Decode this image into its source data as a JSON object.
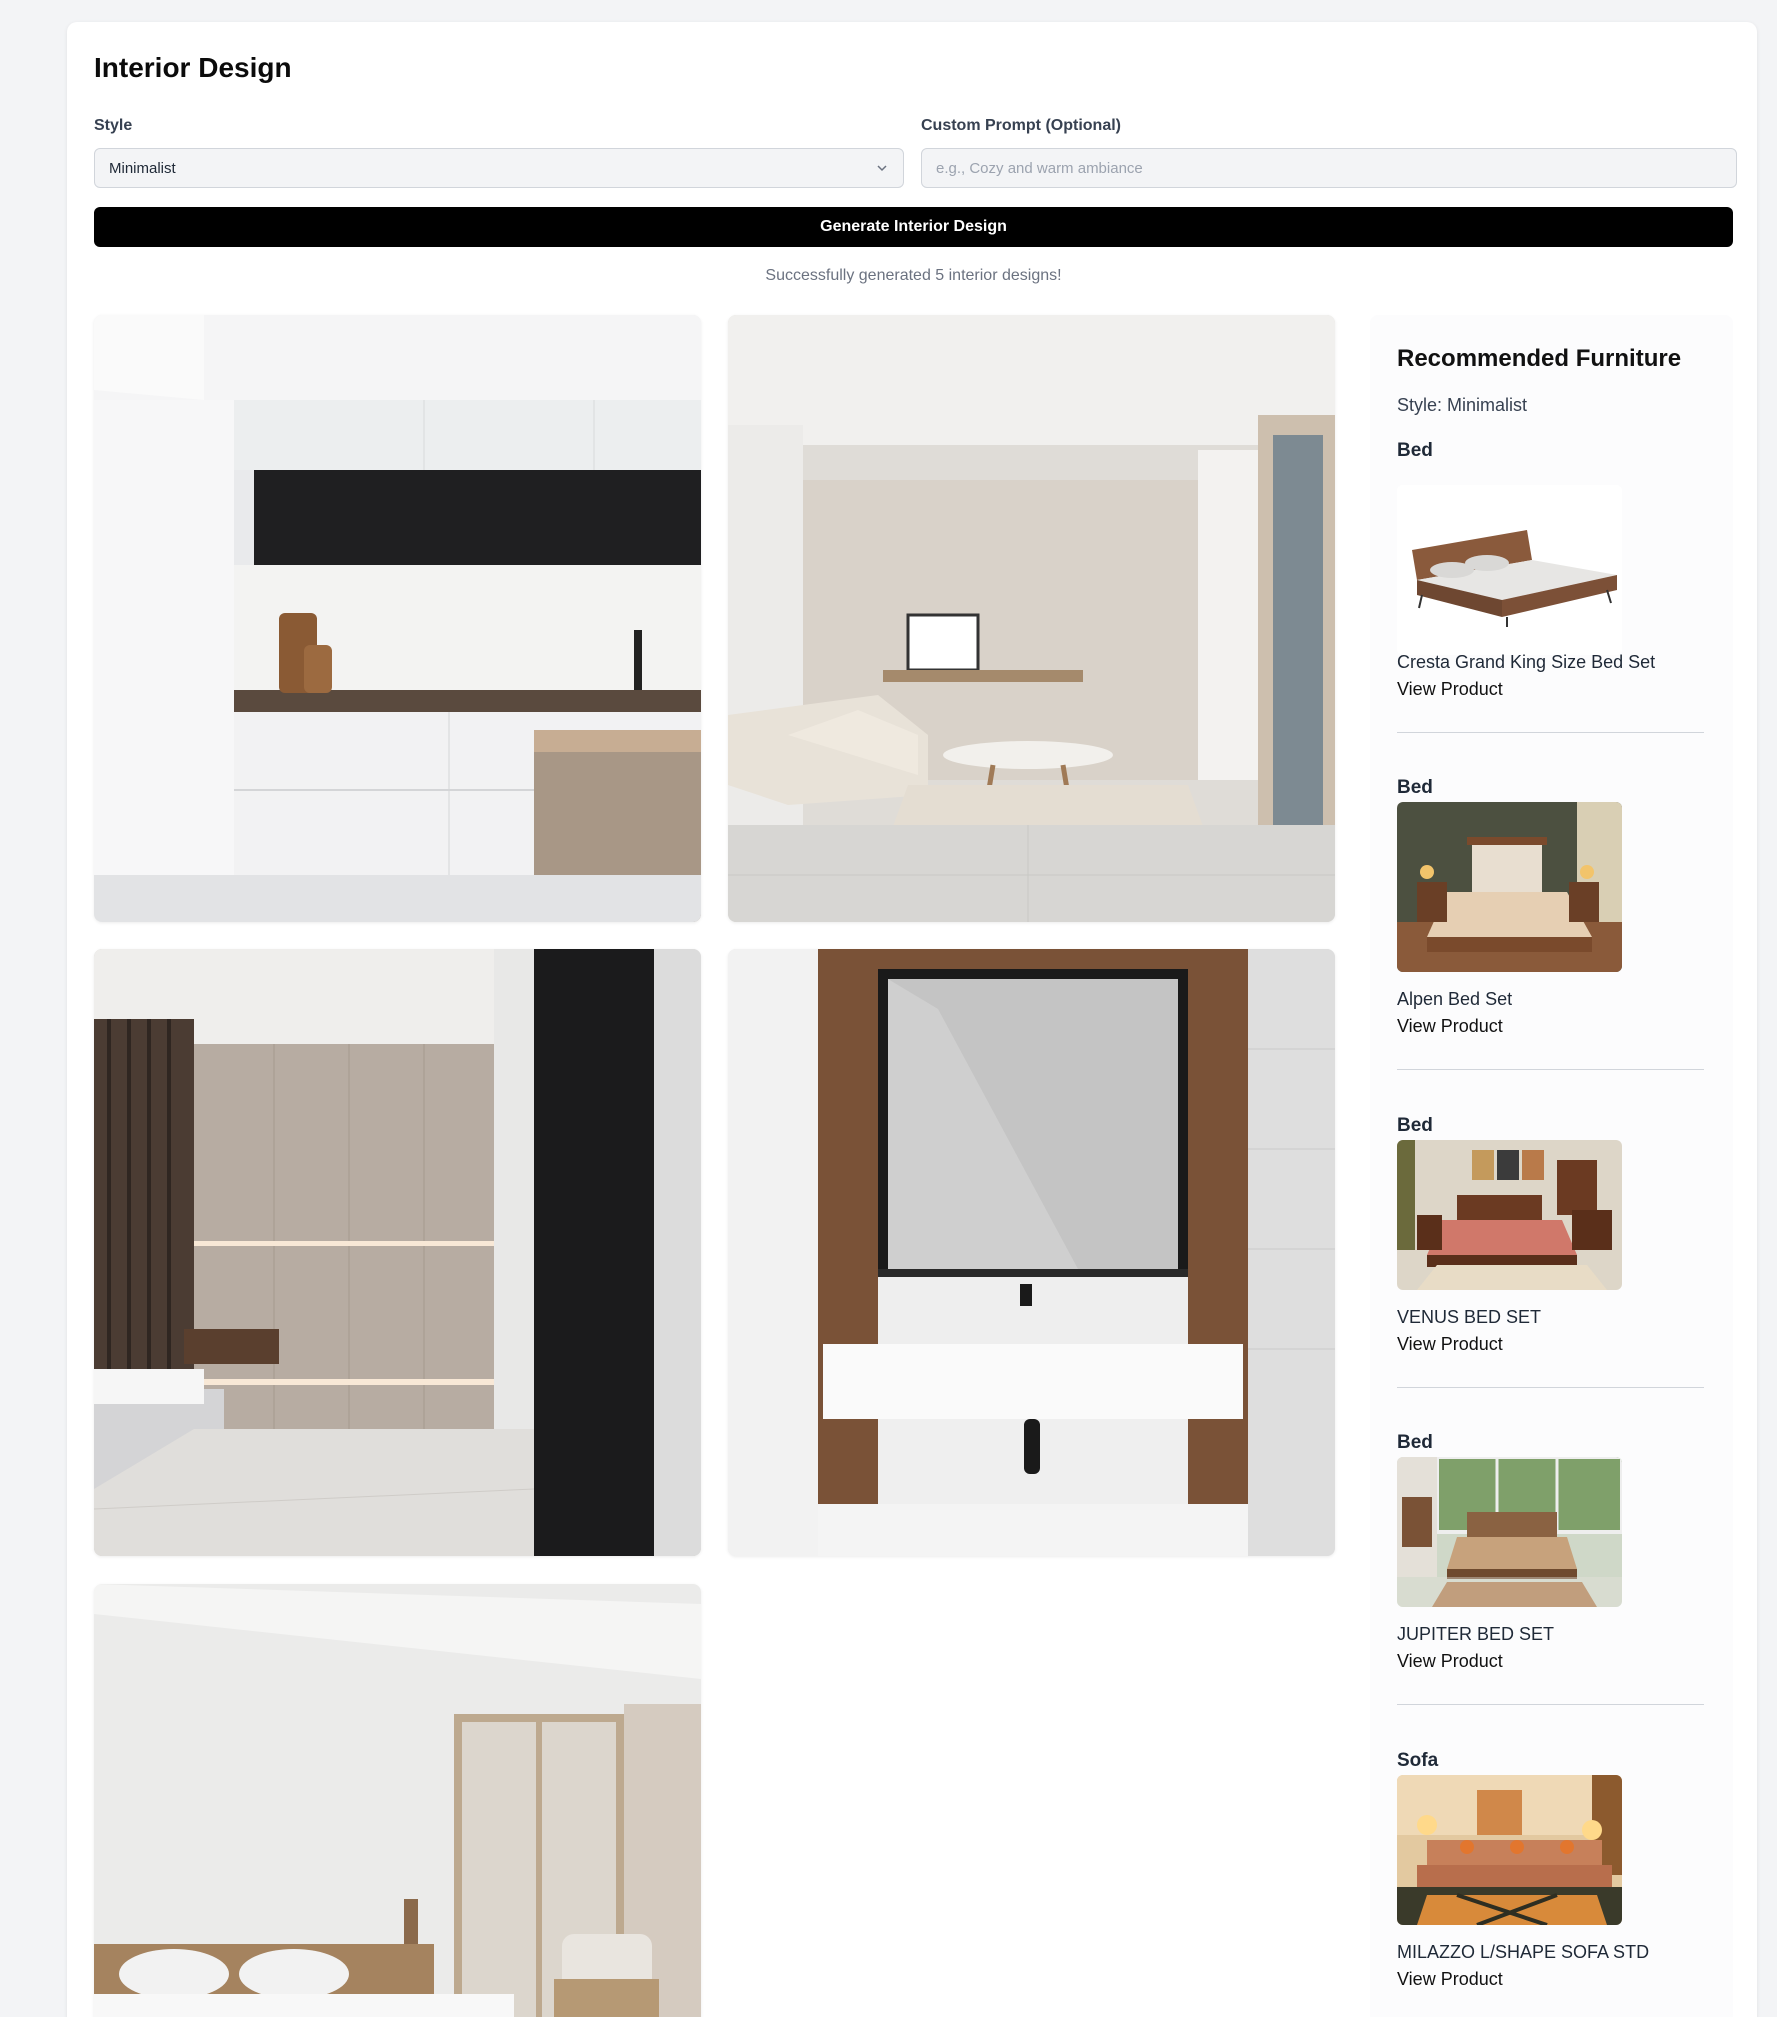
{
  "page": {
    "title": "Interior Design",
    "style_label": "Style",
    "style_value": "Minimalist",
    "prompt_label": "Custom Prompt (Optional)",
    "prompt_placeholder": "e.g., Cozy and warm ambiance",
    "prompt_value": "",
    "generate_label": "Generate Interior Design",
    "status": "Successfully generated 5 interior designs!"
  },
  "gallery": [
    {
      "subject": "minimalist kitchen"
    },
    {
      "subject": "minimalist living room"
    },
    {
      "subject": "minimalist bedroom wall"
    },
    {
      "subject": "minimalist bathroom vanity"
    },
    {
      "subject": "minimalist bedroom"
    }
  ],
  "recommendations": {
    "title": "Recommended Furniture",
    "style_line": "Style: Minimalist",
    "link_label": "View Product",
    "items": [
      {
        "category": "Bed",
        "name": "Cresta Grand King Size Bed Set"
      },
      {
        "category": "Bed",
        "name": "Alpen Bed Set"
      },
      {
        "category": "Bed",
        "name": "VENUS BED SET"
      },
      {
        "category": "Bed",
        "name": "JUPITER BED SET"
      },
      {
        "category": "Sofa",
        "name": "MILAZZO L/SHAPE SOFA STD"
      }
    ]
  },
  "icons": {
    "select_chevron": "chevron-down-icon"
  },
  "colors": {
    "button_bg": "#000000",
    "button_text": "#ffffff",
    "page_bg": "#f3f4f6"
  }
}
